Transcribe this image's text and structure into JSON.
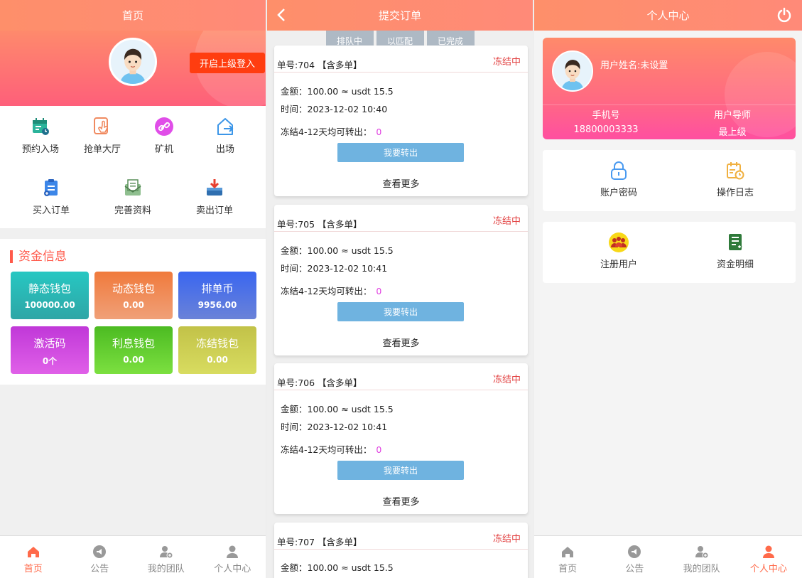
{
  "home": {
    "title": "首页",
    "login_button": "开启上级登入",
    "menu": [
      "预约入场",
      "抢单大厅",
      "矿机",
      "出场",
      "买入订单",
      "完善资料",
      "卖出订单"
    ],
    "fund_title": "资金信息",
    "wallets": [
      {
        "name": "静态钱包",
        "value": "100000.00",
        "color": "#2cb8b8"
      },
      {
        "name": "动态钱包",
        "value": "0.00",
        "color": "#ee7a4a"
      },
      {
        "name": "排单币",
        "value": "9956.00",
        "color": "#4a6ee8"
      },
      {
        "name": "激活码",
        "value": "0个",
        "color": "#d040d8"
      },
      {
        "name": "利息钱包",
        "value": "0.00",
        "color": "#60cc30"
      },
      {
        "name": "冻结钱包",
        "value": "0.00",
        "color": "#c8cc48"
      }
    ]
  },
  "orders_page": {
    "title": "提交订单",
    "tabs": [
      "排队中",
      "以匹配",
      "已完成"
    ],
    "orders": [
      {
        "no": "单号:704 【含多单】",
        "status": "冻结中",
        "amount": "金额：100.00 ≈ usdt 15.5",
        "time": "时间：2023-12-02 10:40",
        "freeze": "冻结4-12天均可转出：",
        "freeze_value": "0",
        "button": "我要转出",
        "more": "查看更多"
      },
      {
        "no": "单号:705 【含多单】",
        "status": "冻结中",
        "amount": "金额：100.00 ≈ usdt 15.5",
        "time": "时间：2023-12-02 10:41",
        "freeze": "冻结4-12天均可转出：",
        "freeze_value": "0",
        "button": "我要转出",
        "more": "查看更多"
      },
      {
        "no": "单号:706 【含多单】",
        "status": "冻结中",
        "amount": "金额：100.00 ≈ usdt 15.5",
        "time": "时间：2023-12-02 10:41",
        "freeze": "冻结4-12天均可转出：",
        "freeze_value": "0",
        "button": "我要转出",
        "more": "查看更多"
      },
      {
        "no": "单号:707 【含多单】",
        "status": "冻结中",
        "amount": "金额：100.00 ≈ usdt 15.5"
      }
    ]
  },
  "profile": {
    "title": "个人中心",
    "username": "用户姓名:未设置",
    "phone_label": "手机号",
    "phone": "18800003333",
    "mentor_label": "用户导师",
    "mentor": "最上级",
    "items": [
      "账户密码",
      "操作日志",
      "注册用户",
      "资金明细"
    ]
  },
  "tabbar": [
    "首页",
    "公告",
    "我的团队",
    "个人中心"
  ],
  "colors": {
    "accent": "#ff6a4a",
    "header": "#fe8f6a",
    "button_blue": "#6fb3e0"
  }
}
